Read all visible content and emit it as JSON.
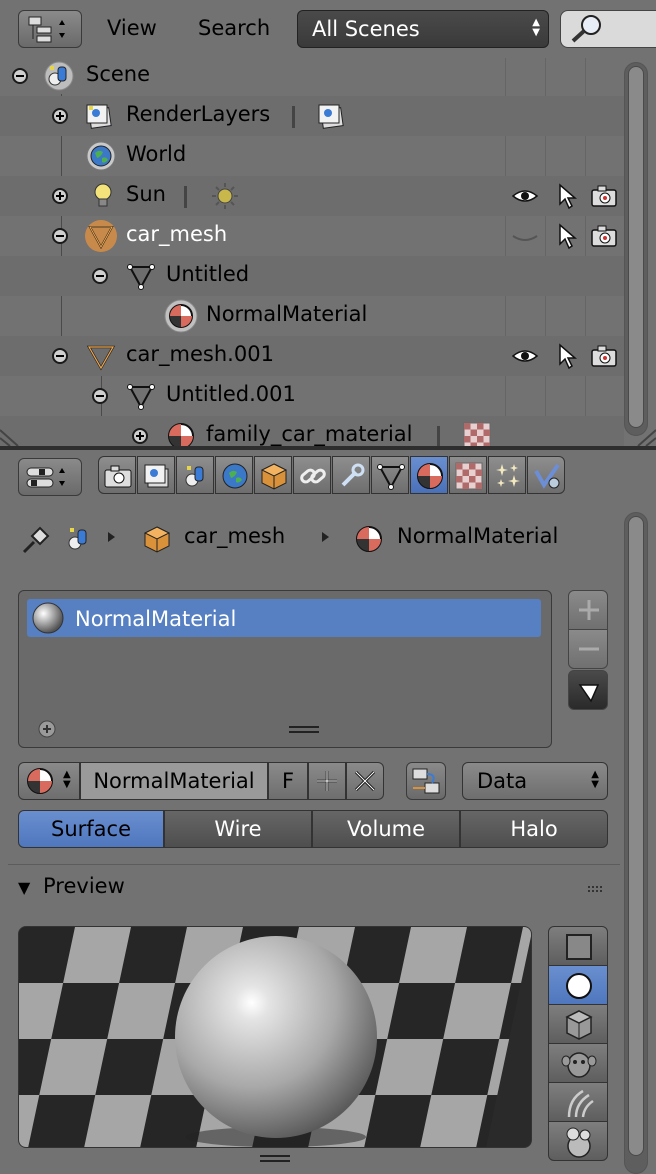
{
  "outliner": {
    "header": {
      "menu_view": "View",
      "menu_search": "Search",
      "scene_filter": "All Scenes"
    },
    "rows": [
      {
        "label": "Scene",
        "icon": "scene-icon"
      },
      {
        "label": "RenderLayers",
        "icon": "render-layers-icon"
      },
      {
        "label": "World",
        "icon": "world-icon"
      },
      {
        "label": "Sun",
        "icon": "lamp-icon"
      },
      {
        "label": "car_mesh",
        "icon": "mesh-object-icon"
      },
      {
        "label": "Untitled",
        "icon": "mesh-data-icon"
      },
      {
        "label": "NormalMaterial",
        "icon": "material-icon"
      },
      {
        "label": "car_mesh.001",
        "icon": "mesh-object-icon"
      },
      {
        "label": "Untitled.001",
        "icon": "mesh-data-icon"
      },
      {
        "label": "family_car_material",
        "icon": "material-icon"
      }
    ]
  },
  "properties": {
    "breadcrumb": {
      "object": "car_mesh",
      "material": "NormalMaterial"
    },
    "material_slots": [
      {
        "label": "NormalMaterial",
        "selected": true
      }
    ],
    "datablock": {
      "name": "NormalMaterial",
      "fake_user": "F"
    },
    "link_dropdown": "Data",
    "type_tabs": [
      {
        "label": "Surface",
        "active": true
      },
      {
        "label": "Wire",
        "active": false
      },
      {
        "label": "Volume",
        "active": false
      },
      {
        "label": "Halo",
        "active": false
      }
    ],
    "preview": {
      "title": "Preview"
    }
  },
  "colors": {
    "background": "#727272",
    "active_blue": "#5680c2",
    "panel_dark": "#3a3a3a"
  }
}
